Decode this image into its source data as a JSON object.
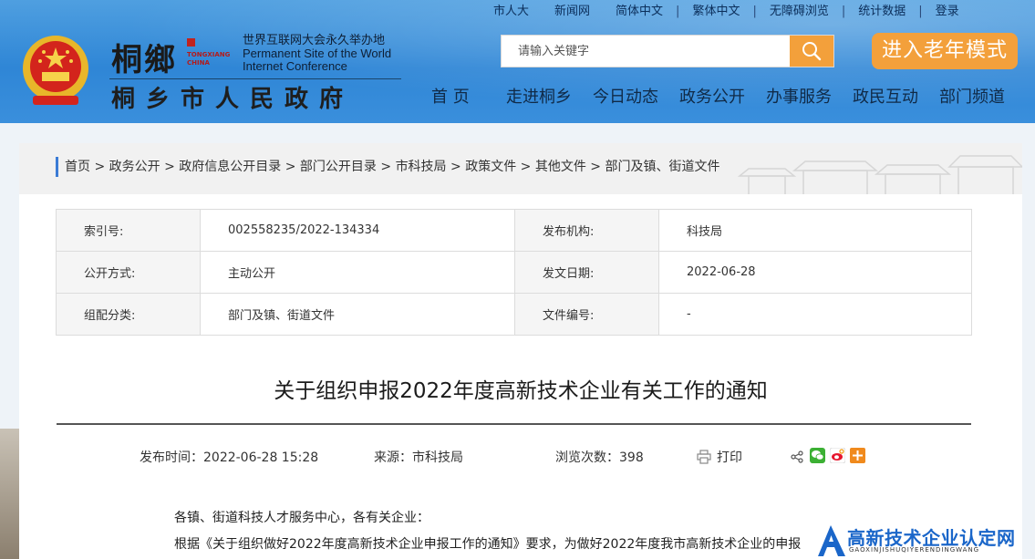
{
  "topbar": {
    "links": [
      "市人大",
      "新闻网",
      "简体中文",
      "繁体中文",
      "无障碍浏览",
      "统计数据",
      "登录"
    ]
  },
  "logo": {
    "seal_text": "桐鄉",
    "pinyin_line1": "TONGXIANG",
    "pinyin_line2": "CHINA",
    "slogan_cn": "世界互联网大会永久举办地",
    "slogan_en1": "Permanent Site of the World",
    "slogan_en2": "Internet Conference",
    "gov_name": "桐乡市人民政府"
  },
  "search": {
    "placeholder": "请输入关键字"
  },
  "elder_mode": "进入老年模式",
  "nav": {
    "items": [
      "首 页",
      "走进桐乡",
      "今日动态",
      "政务公开",
      "办事服务",
      "政民互动",
      "部门频道"
    ]
  },
  "breadcrumb": {
    "items": [
      "首页",
      "政务公开",
      "政府信息公开目录",
      "部门公开目录",
      "市科技局",
      "政策文件",
      "其他文件",
      "部门及镇、街道文件"
    ],
    "separator": " > "
  },
  "meta": {
    "rows": [
      {
        "k1": "索引号:",
        "v1": "002558235/2022-134334",
        "k2": "发布机构:",
        "v2": "科技局"
      },
      {
        "k1": "公开方式:",
        "v1": "主动公开",
        "k2": "发文日期:",
        "v2": "2022-06-28"
      },
      {
        "k1": "组配分类:",
        "v1": "部门及镇、街道文件",
        "k2": "文件编号:",
        "v2": "-"
      }
    ]
  },
  "article": {
    "title": "关于组织申报2022年度高新技术企业有关工作的通知",
    "publish_time_label": "发布时间：2022-06-28  15:28",
    "source_label": "来源：市科技局",
    "views_label": "浏览次数：398",
    "print_label": "打印",
    "greeting": "各镇、街道科技人才服务中心，各有关企业：",
    "para1": "根据《关于组织做好2022年度高新技术企业申报工作的通知》要求，为做好2022年度我市高新技术企业的申报"
  },
  "watermark": {
    "text": "高新技术企业认定网",
    "sub": "GAOXINJISHUQIYERENDINGWANG"
  },
  "colors": {
    "header_blue": "#2f86d6",
    "accent_orange": "#f3a03b",
    "crumb_bar": "#3a7bd5"
  }
}
